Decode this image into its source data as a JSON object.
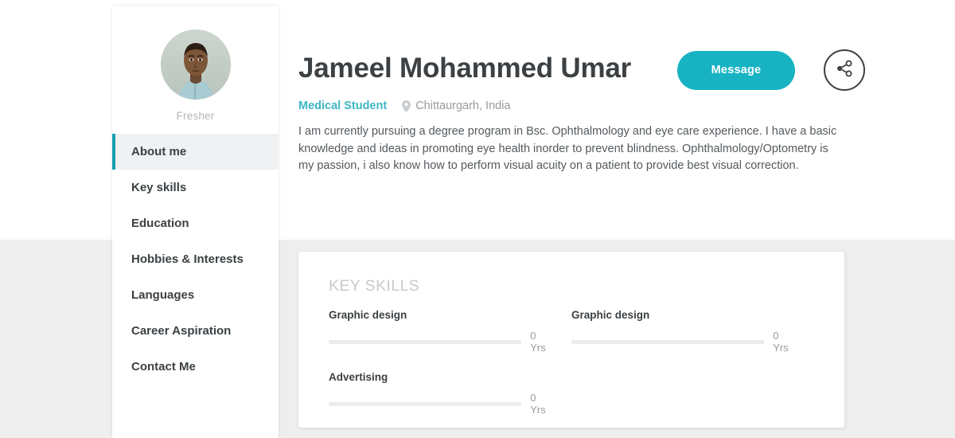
{
  "sidebar": {
    "avatar_caption": "Fresher",
    "avatar_icon": "profile-photo",
    "items": [
      {
        "label": "About me",
        "active": true
      },
      {
        "label": "Key skills",
        "active": false
      },
      {
        "label": "Education",
        "active": false
      },
      {
        "label": "Hobbies & Interests",
        "active": false
      },
      {
        "label": "Languages",
        "active": false
      },
      {
        "label": "Career Aspiration",
        "active": false
      },
      {
        "label": "Contact Me",
        "active": false
      }
    ]
  },
  "profile": {
    "name": "Jameel Mohammed Umar",
    "role": "Medical Student",
    "location": "Chittaurgarh, India",
    "location_icon": "map-pin-icon",
    "bio": "I am currently pursuing a degree program in Bsc. Ophthalmology and eye care experience. I have a basic knowledge and ideas in promoting eye health inorder to prevent blindness. Ophthalmology/Optometry is my passion, i also know how to perform visual acuity on a patient to provide best visual correction."
  },
  "actions": {
    "message_label": "Message",
    "share_icon": "share-nodes-icon"
  },
  "skills_section": {
    "title": "KEY SKILLS",
    "items": [
      {
        "name": "Graphic design",
        "years": "0 Yrs"
      },
      {
        "name": "Graphic design",
        "years": "0 Yrs"
      },
      {
        "name": "Advertising",
        "years": "0 Yrs"
      }
    ]
  },
  "colors": {
    "accent_teal": "#17b3c3",
    "role_teal": "#3db6c4",
    "active_bar": "#1a9eae",
    "page_bg": "#eeeeee",
    "text_dark": "#3c4043",
    "text_muted": "#9a9a9a"
  }
}
